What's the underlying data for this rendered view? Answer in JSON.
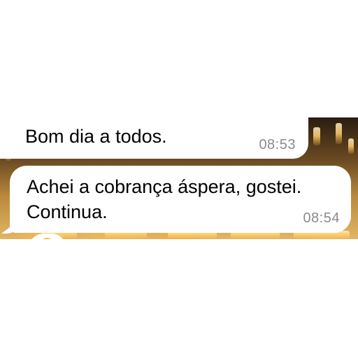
{
  "messages": [
    {
      "text": "Bom dia a todos.",
      "time": "08:53"
    },
    {
      "text": "Achei a cobrança áspera, gostei. Continua.",
      "time": "08:54"
    }
  ],
  "colors": {
    "bubble_background": "#ffffff",
    "message_text": "#000000",
    "timestamp_text": "#8a8a8a"
  },
  "icons": {
    "reaction": "emoji-reaction-icon"
  }
}
